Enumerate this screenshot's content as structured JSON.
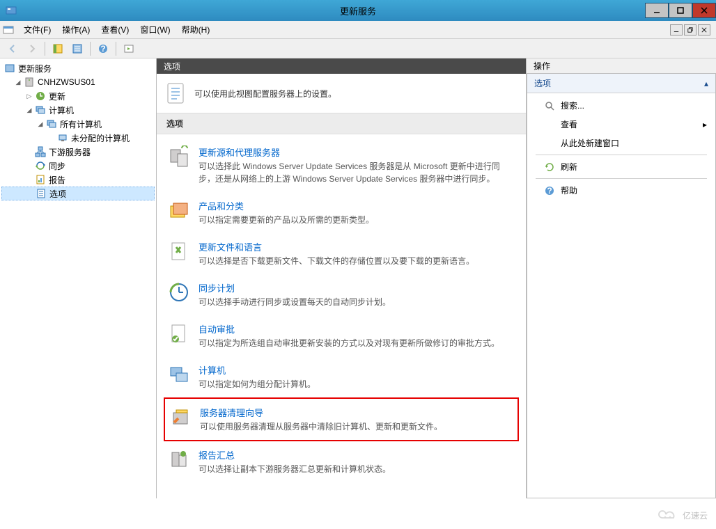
{
  "window": {
    "title": "更新服务"
  },
  "menubar": {
    "file": "文件(F)",
    "action": "操作(A)",
    "view": "查看(V)",
    "window": "窗口(W)",
    "help": "帮助(H)"
  },
  "tree": {
    "root": "更新服务",
    "server": "CNHZWSUS01",
    "updates": "更新",
    "computers": "计算机",
    "all_computers": "所有计算机",
    "unassigned": "未分配的计算机",
    "downstream": "下游服务器",
    "sync": "同步",
    "reports": "报告",
    "options": "选项"
  },
  "center": {
    "header": "选项",
    "intro": "可以使用此视图配置服务器上的设置。",
    "section_title": "选项",
    "options": [
      {
        "title": "更新源和代理服务器",
        "desc": "可以选择此 Windows Server Update Services 服务器是从 Microsoft 更新中进行同步，还是从网络上的上游 Windows Server Update Services 服务器中进行同步。"
      },
      {
        "title": "产品和分类",
        "desc": "可以指定需要更新的产品以及所需的更新类型。"
      },
      {
        "title": "更新文件和语言",
        "desc": "可以选择是否下载更新文件、下载文件的存储位置以及要下载的更新语言。"
      },
      {
        "title": "同步计划",
        "desc": "可以选择手动进行同步或设置每天的自动同步计划。"
      },
      {
        "title": "自动审批",
        "desc": "可以指定为所选组自动审批更新安装的方式以及对现有更新所做修订的审批方式。"
      },
      {
        "title": "计算机",
        "desc": "可以指定如何为组分配计算机。"
      },
      {
        "title": "服务器清理向导",
        "desc": "可以使用服务器清理从服务器中清除旧计算机、更新和更新文件。"
      },
      {
        "title": "报告汇总",
        "desc": "可以选择让副本下游服务器汇总更新和计算机状态。"
      }
    ]
  },
  "actions": {
    "header": "操作",
    "section": "选项",
    "search": "搜索...",
    "view": "查看",
    "new_window": "从此处新建窗口",
    "refresh": "刷新",
    "help": "帮助"
  },
  "watermark": "亿速云"
}
